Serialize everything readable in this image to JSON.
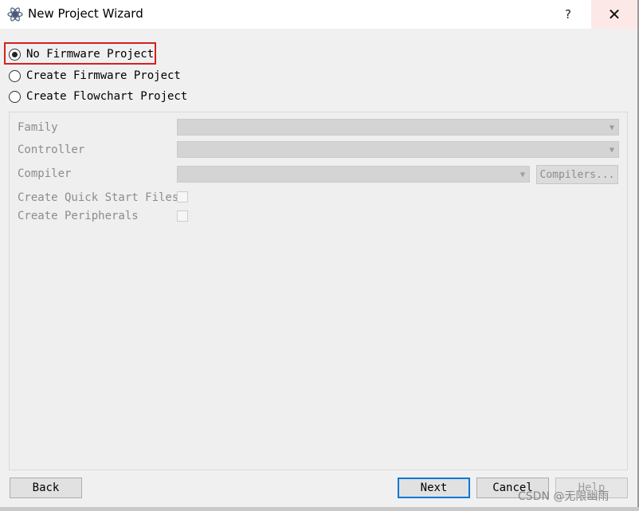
{
  "window": {
    "title": "New Project Wizard",
    "help_label": "?",
    "close_label": "✕"
  },
  "project_type": {
    "options": [
      {
        "label": "No Firmware Project",
        "checked": true
      },
      {
        "label": "Create Firmware Project",
        "checked": false
      },
      {
        "label": "Create Flowchart Project",
        "checked": false
      }
    ]
  },
  "form": {
    "family_label": "Family",
    "controller_label": "Controller",
    "compiler_label": "Compiler",
    "compilers_button": "Compilers...",
    "quick_start_label": "Create Quick Start Files",
    "peripherals_label": "Create Peripherals"
  },
  "footer": {
    "back_label": "Back",
    "next_label": "Next",
    "cancel_label": "Cancel",
    "help_label": "Help"
  },
  "watermark": "CSDN @无限幽雨",
  "colors": {
    "highlight_border": "#d42020",
    "primary_border": "#0078d7"
  }
}
